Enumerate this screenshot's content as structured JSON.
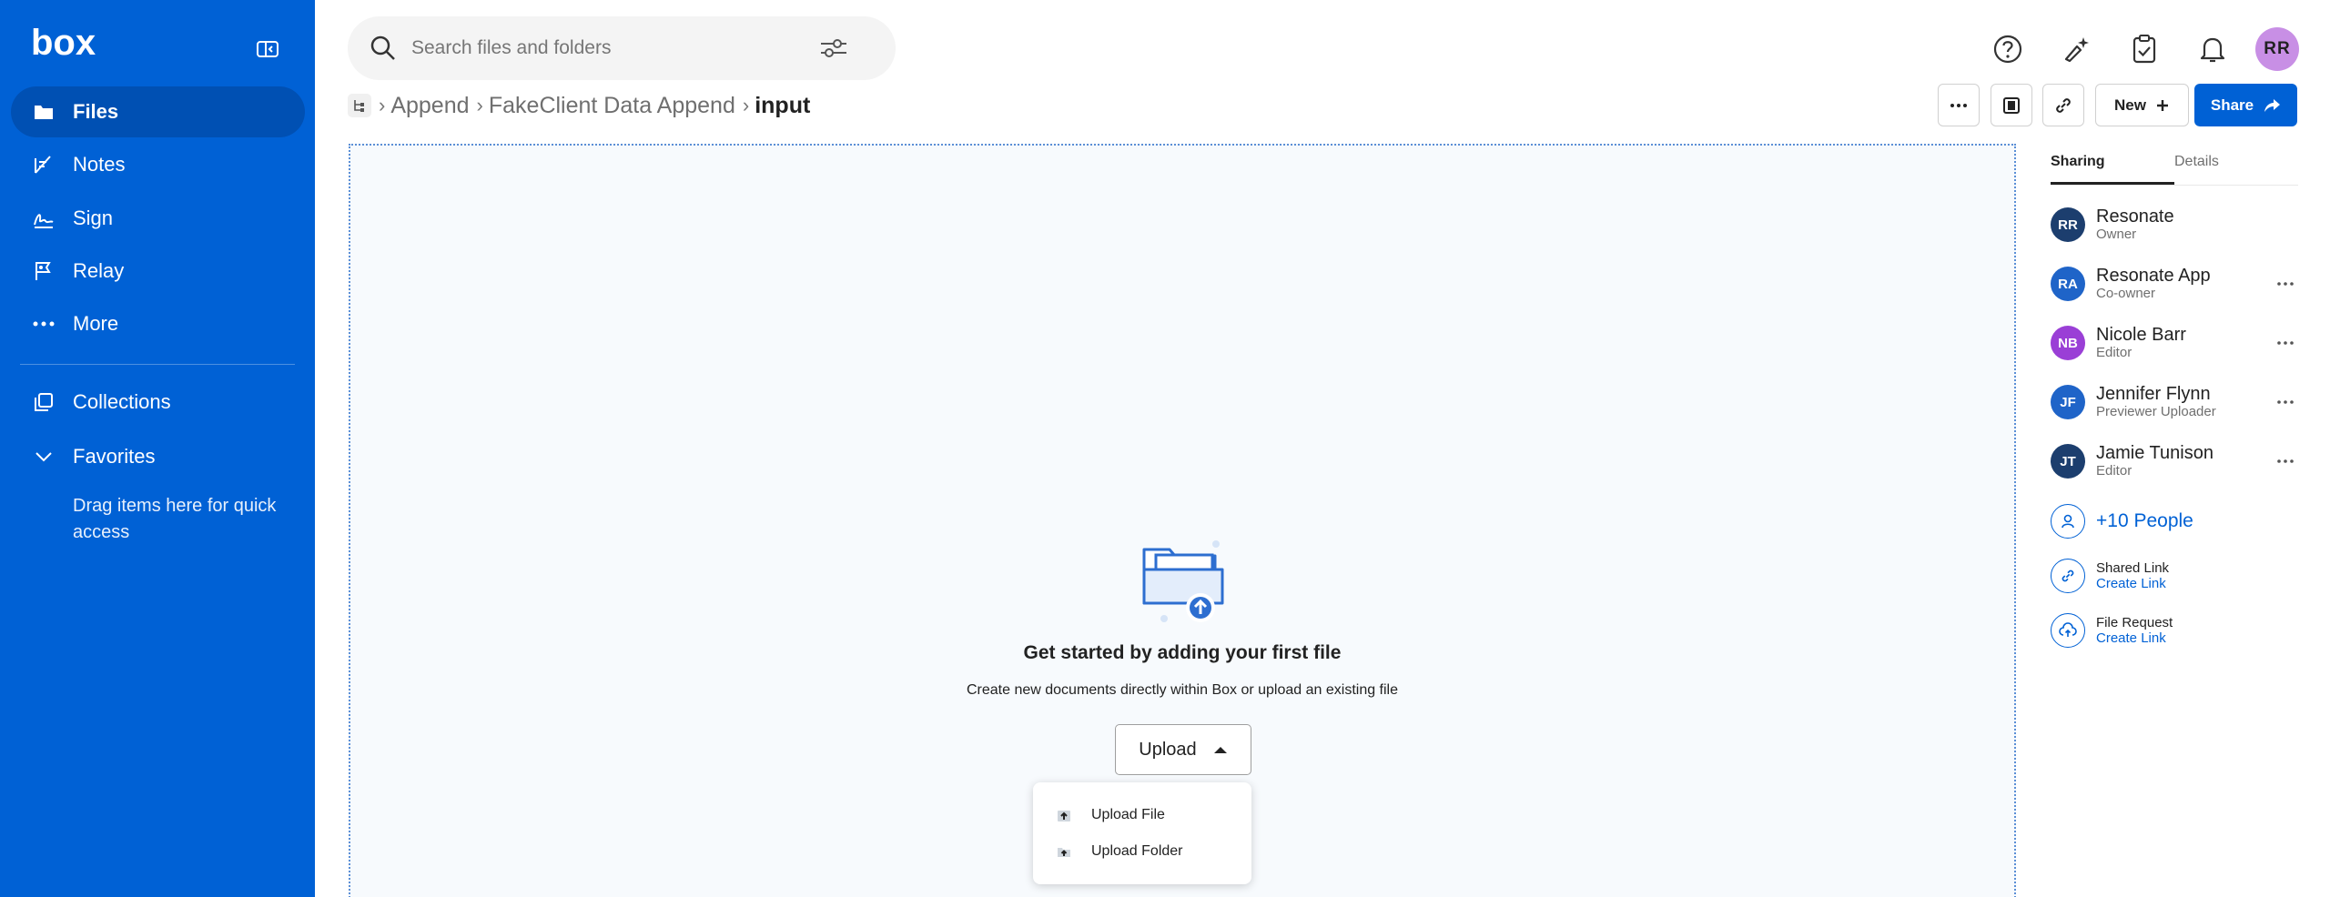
{
  "brand": {
    "logo_text": "box",
    "accent": "#0061d5"
  },
  "sidebar": {
    "items": [
      {
        "label": "Files",
        "icon": "folder-icon",
        "active": true
      },
      {
        "label": "Notes",
        "icon": "notes-icon"
      },
      {
        "label": "Sign",
        "icon": "sign-icon"
      },
      {
        "label": "Relay",
        "icon": "relay-icon"
      },
      {
        "label": "More",
        "icon": "more-icon"
      },
      {
        "label": "Collections",
        "icon": "collections-icon"
      },
      {
        "label": "Favorites",
        "icon": "chevron-down-icon"
      }
    ],
    "favorites_hint": "Drag items here for quick access"
  },
  "search": {
    "placeholder": "Search files and folders"
  },
  "user": {
    "initials": "RR"
  },
  "breadcrumb": {
    "items": [
      "Append",
      "FakeClient Data Append"
    ],
    "current": "input"
  },
  "toolbar": {
    "new_label": "New",
    "share_label": "Share"
  },
  "empty_state": {
    "title": "Get started by adding your first file",
    "subtitle": "Create new documents directly within Box or upload an existing file",
    "upload_label": "Upload",
    "menu": [
      "Upload File",
      "Upload Folder"
    ]
  },
  "panel": {
    "tabs": [
      "Sharing",
      "Details"
    ],
    "collaborators": [
      {
        "initials": "RR",
        "name": "Resonate",
        "role": "Owner",
        "color": "#1c3e6e"
      },
      {
        "initials": "RA",
        "name": "Resonate App",
        "role": "Co-owner",
        "color": "#1f64c8"
      },
      {
        "initials": "NB",
        "name": "Nicole Barr",
        "role": "Editor",
        "color": "#9a3fd6"
      },
      {
        "initials": "JF",
        "name": "Jennifer Flynn",
        "role": "Previewer Uploader",
        "color": "#1f64c8"
      },
      {
        "initials": "JT",
        "name": "Jamie Tunison",
        "role": "Editor",
        "color": "#1c3e6e"
      }
    ],
    "people_more": "+10 People",
    "shared_link": {
      "title": "Shared Link",
      "action": "Create Link"
    },
    "file_request": {
      "title": "File Request",
      "action": "Create Link"
    }
  }
}
